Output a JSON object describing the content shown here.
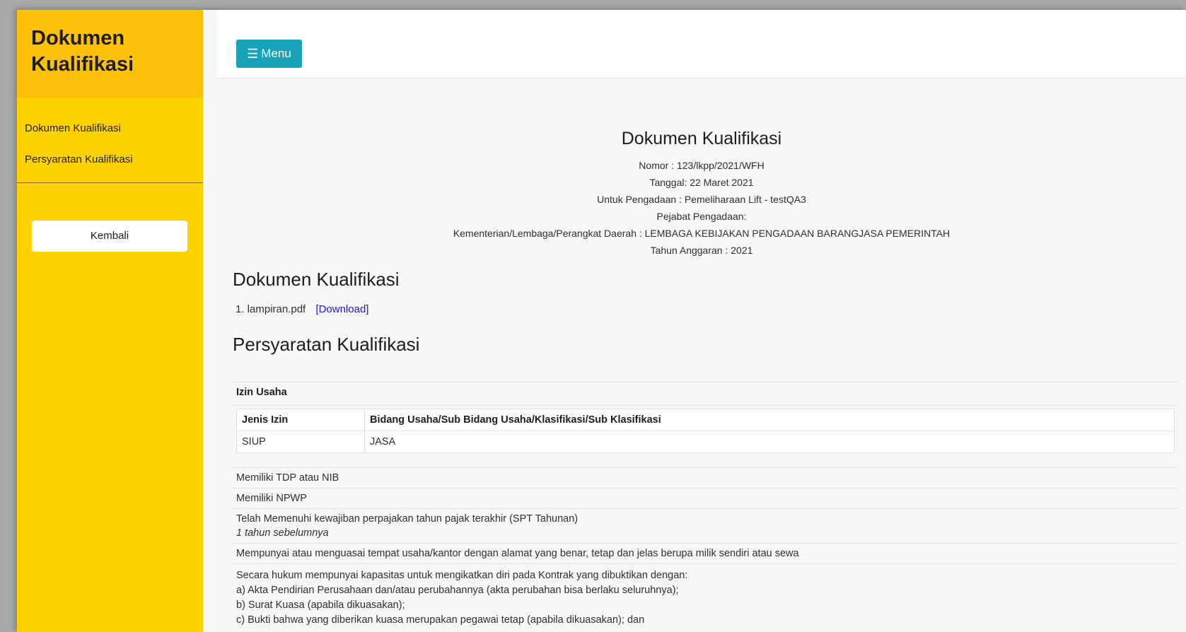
{
  "sidebar": {
    "title": "Dokumen Kualifikasi",
    "items": [
      {
        "label": "Dokumen Kualifikasi"
      },
      {
        "label": "Persyaratan Kualifikasi"
      }
    ],
    "back_label": "Kembali"
  },
  "topbar": {
    "menu_label": "Menu",
    "menu_icon": "menu-lines-icon",
    "accent": "#17a2b8"
  },
  "document": {
    "title": "Dokumen Kualifikasi",
    "nomor": "Nomor : 123/lkpp/2021/WFH",
    "tanggal": "Tanggal: 22 Maret 2021",
    "pengadaan": "Untuk Pengadaan : Pemeliharaan Lift - testQA3",
    "pejabat": "Pejabat Pengadaan:",
    "kementerian": "Kementerian/Lembaga/Perangkat Daerah : LEMBAGA KEBIJAKAN PENGADAAN BARANGJASA PEMERINTAH",
    "tahun": "Tahun Anggaran : 2021"
  },
  "files_section": {
    "title": "Dokumen Kualifikasi",
    "files": [
      {
        "name": "1. lampiran.pdf",
        "link": "[Download]"
      }
    ]
  },
  "requirements": {
    "title": "Persyaratan Kualifikasi",
    "izin_heading": "Izin Usaha",
    "table_headers": [
      "Jenis Izin",
      "Bidang Usaha/Sub Bidang Usaha/Klasifikasi/Sub Klasifikasi"
    ],
    "table_rows": [
      [
        "SIUP",
        "JASA"
      ]
    ],
    "items": [
      "Memiliki TDP atau NIB",
      "Memiliki NPWP",
      "Telah Memenuhi kewajiban perpajakan tahun pajak terakhir (SPT Tahunan)",
      "Mempunyai atau menguasai tempat usaha/kantor dengan alamat yang benar, tetap dan jelas berupa milik sendiri atau sewa"
    ],
    "spt_note": "1 tahun sebelumnya",
    "legal": [
      "Secara hukum mempunyai kapasitas untuk mengikatkan diri pada Kontrak yang dibuktikan dengan:",
      "a) Akta Pendirian Perusahaan dan/atau perubahannya (akta perubahan bisa berlaku seluruhnya);",
      "b) Surat Kuasa (apabila dikuasakan);",
      "c) Bukti bahwa yang diberikan kuasa merupakan pegawai tetap (apabila dikuasakan); dan"
    ]
  }
}
